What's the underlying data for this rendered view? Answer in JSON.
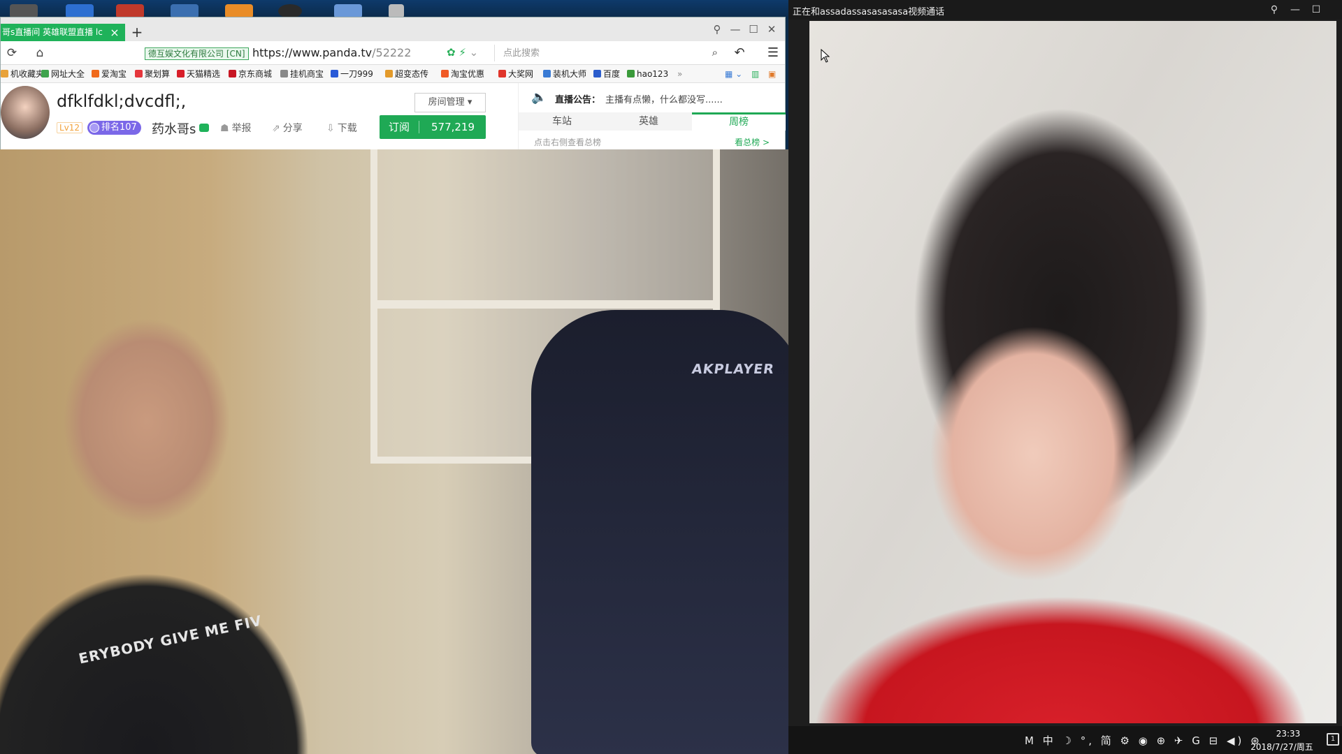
{
  "browser": {
    "tab_title": "哥s直播间 英雄联盟直播 lc",
    "tab_close": "×",
    "new_tab": "+",
    "cert_label": "德互娱文化有限公司 [CN]",
    "url_host": "https://www.panda.tv",
    "url_path": "/52222",
    "search_placeholder": "点此搜索",
    "window_controls": [
      "⚲",
      "—",
      "☐",
      "✕"
    ]
  },
  "bookmarks": [
    {
      "label": "机收藏夹",
      "color": "#e8a23a"
    },
    {
      "label": "网址大全",
      "color": "#3fa34d"
    },
    {
      "label": "爱淘宝",
      "color": "#f06a1b"
    },
    {
      "label": "聚划算",
      "color": "#e5363c"
    },
    {
      "label": "天猫精选",
      "color": "#d81e29"
    },
    {
      "label": "京东商城",
      "color": "#c81623"
    },
    {
      "label": "挂机商宝",
      "color": "#888888"
    },
    {
      "label": "一刀999",
      "color": "#2a5bd7"
    },
    {
      "label": "超变态传",
      "color": "#e39a2a"
    },
    {
      "label": "淘宝优惠",
      "color": "#f05a26"
    },
    {
      "label": "大奖网",
      "color": "#e0352b"
    },
    {
      "label": "装机大师",
      "color": "#3a7bd5"
    },
    {
      "label": "百度",
      "color": "#2b5dcc"
    },
    {
      "label": "hao123",
      "color": "#3a9a3a"
    }
  ],
  "room": {
    "title": "dfklfdkl;dvcdfl;,",
    "room_management": "房间管理",
    "level": "Lv12",
    "rank_badge": "排名107",
    "host_name": "药水哥s",
    "report": "举报",
    "share": "分享",
    "download": "下载",
    "subscribe_label": "订阅",
    "subscribe_count": "577,219"
  },
  "notice": {
    "label": "直播公告：",
    "text": "主播有点懒，什么都没写......",
    "tabs": [
      "车站",
      "英雄",
      "周榜"
    ],
    "active_tab": "周榜",
    "hint": "点击右侧查看总榜",
    "view_all": "看总榜 >"
  },
  "stream": {
    "chair_brand": "AKPLAYER",
    "shirt_text": "ERYBODY GIVE ME FIV"
  },
  "call_window": {
    "title": "正在和assadassasasasasa视频通话",
    "controls": [
      "⚲",
      "—",
      "☐"
    ]
  },
  "taskbar": {
    "tray": "M 中 ☽ °, 简 ⚙ ◉ ⊕ ✈ G ⊟ ◀) ⊛",
    "time": "23:33",
    "date": "2018/7/27/周五",
    "notifications": "1"
  }
}
